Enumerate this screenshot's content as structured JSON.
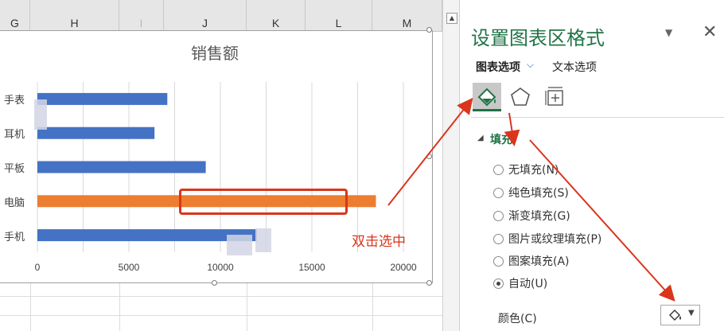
{
  "sheet": {
    "columns": [
      "G",
      "H",
      "I",
      "J",
      "K",
      "L",
      "M"
    ]
  },
  "chart": {
    "handles": [],
    "annotation": "双击选中"
  },
  "chart_data": {
    "type": "bar",
    "orientation": "horizontal",
    "title": "销售额",
    "categories": [
      "手机",
      "电脑",
      "平板",
      "耳机",
      "手表"
    ],
    "values": [
      12000,
      18500,
      9200,
      6400,
      7100
    ],
    "highlight_category": "电脑",
    "bar_color": "#4472c4",
    "highlight_color": "#ed7d31",
    "xlim": [
      0,
      20000
    ],
    "xticks": [
      "0",
      "5000",
      "10000",
      "15000",
      "20000"
    ],
    "grid": true,
    "legend": "none"
  },
  "pane": {
    "title": "设置图表区格式",
    "close": "✕",
    "menu": "▼",
    "tab_chart": "图表选项",
    "tab_chevron": "⌵",
    "tab_text": "文本选项",
    "icons": [
      "fill-line-icon",
      "effects-pentagon-icon",
      "size-properties-icon"
    ],
    "fill_section": {
      "arrow": "◢",
      "title": "填充",
      "options": [
        {
          "label": "无填充(N)",
          "checked": false
        },
        {
          "label": "纯色填充(S)",
          "checked": false
        },
        {
          "label": "渐变填充(G)",
          "checked": false
        },
        {
          "label": "图片或纹理填充(P)",
          "checked": false
        },
        {
          "label": "图案填充(A)",
          "checked": false
        },
        {
          "label": "自动(U)",
          "checked": true
        }
      ]
    },
    "color_label": "颜色(C)",
    "color_caret": "▼"
  },
  "accent_color": "#217346",
  "annotation_color": "#d9361c"
}
